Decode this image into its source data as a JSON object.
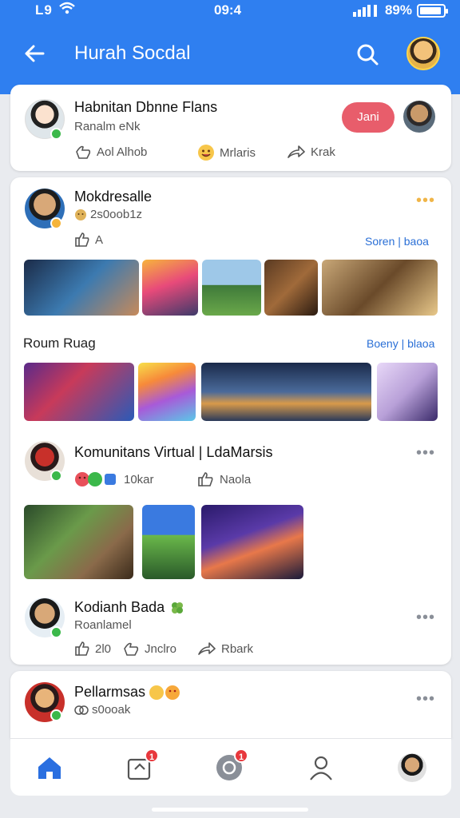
{
  "status_bar": {
    "left": "L9",
    "time": "09:4",
    "battery_text": "89%"
  },
  "appbar": {
    "title": "Hurah Socdal",
    "back_icon": "arrow-left-icon",
    "search_icon": "search-icon"
  },
  "card1": {
    "name": "Habnitan Dbnne Flans",
    "sub": "Ranalm eNk",
    "join_label": "Jani",
    "actions": [
      "Aol Alhob",
      "Mrlaris",
      "Krak"
    ]
  },
  "card2": {
    "post1": {
      "name": "Mokdresalle",
      "sub": "2s0oob1z",
      "like_count": "A",
      "link": "Soren | baoa"
    },
    "section": {
      "title": "Roum Ruag",
      "link": "Boeny | blaoa"
    },
    "post2": {
      "name": "Komunitans Virtual | LdaMarsis",
      "reactions": "10kar",
      "share": "Naola"
    },
    "post3": {
      "name": "Kodianh Bada",
      "sub": "Roanlamel",
      "actions": [
        "2l0",
        "Jnclro",
        "Rbark"
      ]
    }
  },
  "card3": {
    "name": "Pellarmsas",
    "sub": "s0ooak"
  },
  "bottom_nav": {
    "items": [
      "home-icon",
      "notifications-icon",
      "messages-icon",
      "profile-icon",
      "avatar"
    ],
    "badges": [
      "1",
      "1"
    ]
  },
  "colors": {
    "primary": "#2f7ff0",
    "join": "#e85d6b",
    "link": "#2a6fd6",
    "online": "#3bb84a"
  }
}
